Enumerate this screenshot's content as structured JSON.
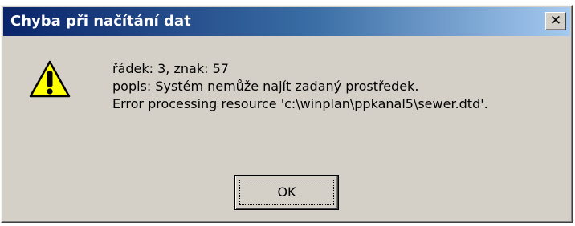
{
  "dialog": {
    "title": "Chyba při načítání dat",
    "close_label": "✕",
    "icon": "warning-icon",
    "message_lines": [
      "řádek: 3, znak: 57",
      "popis: Systém nemůže najít zadaný prostředek.",
      "Error processing resource 'c:\\winplan\\ppkanal5\\sewer.dtd'."
    ],
    "ok_label": "OK"
  },
  "colors": {
    "title_gradient_start": "#0a246a",
    "title_gradient_end": "#a6caf0",
    "window_face": "#d4d0c8",
    "warning_yellow": "#ffff00"
  }
}
